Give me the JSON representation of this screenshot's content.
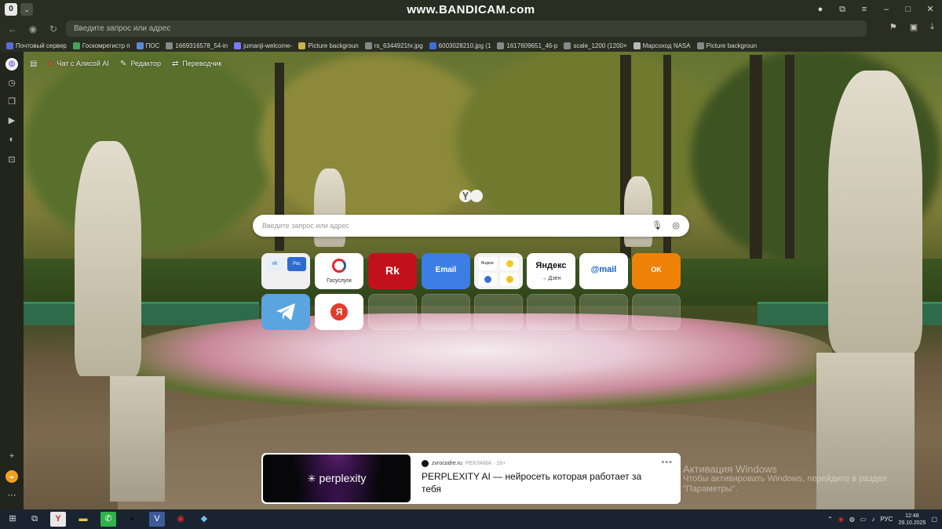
{
  "recorder_watermark": "www.BANDICAM.com",
  "titlebar": {
    "tab_switcher_label": "0",
    "tab_menu_icon": "chevron-down-icon"
  },
  "navbar": {
    "address_placeholder": "Введите запрос или адрес"
  },
  "bookmarks": [
    {
      "label": "Почтовый сервер",
      "icon_color": "#5a6fd6"
    },
    {
      "label": "Госкомрегистр п",
      "icon_color": "#49a35a"
    },
    {
      "label": "ПОС",
      "icon_color": "#5a8ad6"
    },
    {
      "label": "1669316578_54-in",
      "icon_color": "#888888"
    },
    {
      "label": "jumanji-welcome-",
      "icon_color": "#7a7aff"
    },
    {
      "label": "Picture backgroun",
      "icon_color": "#c8b24a"
    },
    {
      "label": "rs_6344921hr.jpg",
      "icon_color": "#888888"
    },
    {
      "label": "6003028210.jpg (1",
      "icon_color": "#3b6fd6"
    },
    {
      "label": "1617609651_46-p",
      "icon_color": "#888888"
    },
    {
      "label": "scale_1200 (1200×",
      "icon_color": "#888888"
    },
    {
      "label": "Марсоход NASA",
      "icon_color": "#bbbbbb"
    },
    {
      "label": "Picture backgroun",
      "icon_color": "#888888"
    }
  ],
  "newtab_toolbar": {
    "alice_chat": "Чат с Алисой AI",
    "editor": "Редактор",
    "translator": "Переводчик"
  },
  "search": {
    "placeholder": "Введите запрос или адрес"
  },
  "tiles_row1": [
    {
      "name": "vk-group",
      "label": ""
    },
    {
      "name": "gosuslugi",
      "label": "Госуслуги"
    },
    {
      "name": "rk",
      "label": "Rk"
    },
    {
      "name": "email",
      "label": "Email"
    },
    {
      "name": "yandex-group",
      "label": ""
    },
    {
      "name": "yandex-dzen",
      "label": "Яндекс",
      "sub": "→ Дзен"
    },
    {
      "name": "mail-ru",
      "label": "@mail"
    },
    {
      "name": "ok",
      "label": "OK"
    }
  ],
  "tiles_row2": [
    {
      "name": "telegram",
      "label": ""
    },
    {
      "name": "yandex",
      "label": "Я"
    }
  ],
  "news": {
    "brand": "perplexity",
    "source": "zvrocodre.ru",
    "ad_label": "РЕКЛАМА · 16+",
    "headline": "PERPLEXITY AI — нейросеть которая работает за тебя",
    "more_label": "•••"
  },
  "activation_watermark": {
    "title": "Активация Windows",
    "text": "Чтобы активировать Windows, перейдите в раздел \"Параметры\"."
  },
  "taskbar": {
    "language": "РУС",
    "time": "12:48",
    "date": "29.10.2025"
  }
}
